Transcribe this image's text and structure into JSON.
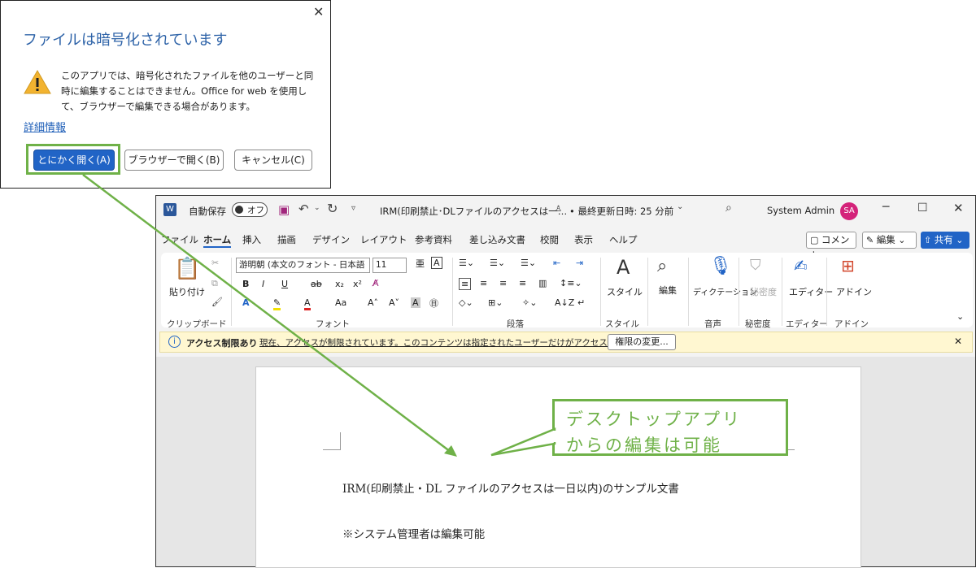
{
  "dialog": {
    "title": "ファイルは暗号化されています",
    "message": "このアプリでは、暗号化されたファイルを他のユーザーと同時に編集することはできません。Office for web を使用して、ブラウザーで編集できる場合があります。",
    "link": "詳細情報",
    "btn_open": "とにかく開く(A)",
    "btn_browser": "ブラウザーで開く(B)",
    "btn_cancel": "キャンセル(C)",
    "close": "✕"
  },
  "titlebar": {
    "autosave": "自動保存",
    "toggle": "オフ",
    "doc_title": "IRM(印刷禁止･DLファイルのアクセスは一…",
    "saved": "• 最終更新日時: 25 分前",
    "user": "System Admin",
    "avatar": "SA"
  },
  "menu": [
    "ファイル",
    "ホーム",
    "挿入",
    "描画",
    "デザイン",
    "レイアウト",
    "参考資料",
    "差し込み文書",
    "校閲",
    "表示",
    "ヘルプ"
  ],
  "menu_right": {
    "comment": "コメント",
    "edit": "編集",
    "share": "共有"
  },
  "ribbon": {
    "paste": "貼り付け",
    "font_name": "游明朝 (本文のフォント - 日本語",
    "font_size": "11",
    "style": "スタイル",
    "edit": "編集",
    "dictate": "ディクテーション",
    "sensitivity": "秘密度",
    "editor": "エディター",
    "addin": "アドイン",
    "groups": [
      "クリップボード",
      "フォント",
      "段落",
      "スタイル",
      "音声",
      "秘密度",
      "エディター",
      "アドイン"
    ]
  },
  "infobar": {
    "label": "アクセス制限あり",
    "text": "現在、アクセスが制限されています。このコンテンツは指定されたユーザーだけがアクセスできます。",
    "button": "権限の変更..."
  },
  "callout": {
    "line1": "デスクトップアプリ",
    "line2": "からの編集は可能"
  },
  "doc": {
    "line1": "IRM(印刷禁止・DL ファイルのアクセスは一日以内)のサンプル文書",
    "line2": "※システム管理者は編集可能"
  },
  "colors": {
    "accent": "#2164c6",
    "green": "#6fb148",
    "avatar": "#d4237a"
  }
}
